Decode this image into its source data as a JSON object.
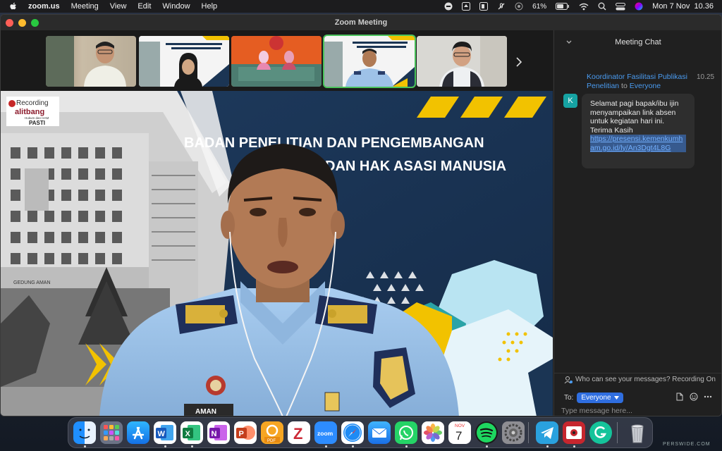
{
  "menubar": {
    "app_name": "zoom.us",
    "menus": [
      "Meeting",
      "View",
      "Edit",
      "Window",
      "Help"
    ],
    "battery": "61%",
    "datetime": "Mon 7 Nov  10.36"
  },
  "window": {
    "title": "Zoom Meeting"
  },
  "gallery": {
    "thumbnails": [
      "participant-1",
      "participant-2",
      "participant-3",
      "participant-4",
      "participant-5"
    ],
    "active_index": 3,
    "next_icon": "chevron-right-icon"
  },
  "main_video": {
    "banner_line1": "BADAN PENELITIAN DAN PENGEMBANGAN",
    "banner_line2": "DAN HAK ASASI MANUSIA",
    "logo_text": "Recording",
    "logo_brand": "alitbang",
    "logo_sub": "Hukum dan HAM",
    "logo_tag": "PASTI",
    "building_sign": "GEDUNG AMAN",
    "name_tag": "AMAN"
  },
  "chat": {
    "header": "Meeting Chat",
    "message": {
      "sender": "Koordinator Fasilitasi Publikasi Penelitian",
      "to_word": "to",
      "recipient": "Everyone",
      "time": "10.25",
      "avatar_letter": "K",
      "text": "Selamat pagi bapak/ibu ijin menyampaikan link absen untuk kegiatan hari ini. Terima Kasih",
      "link": "https://presensi.kemenkumham.go.id/ly/An3Dgt4L8G"
    },
    "notice": "Who can see your messages? Recording On",
    "to_label": "To:",
    "to_value": "Everyone",
    "input_placeholder": "Type message here..."
  },
  "dock": {
    "apps": [
      "Finder",
      "Launchpad",
      "App Store",
      "Word",
      "Excel",
      "OneNote",
      "PowerPoint",
      "PDF",
      "Zotero",
      "Zoom",
      "Safari",
      "Mail",
      "WhatsApp",
      "Photos",
      "Calendar",
      "Spotify",
      "System Preferences",
      "Telegram",
      "Photo Booth",
      "Grammarly",
      "Trash"
    ],
    "calendar_month": "NOV",
    "calendar_day": "7",
    "zoom_label": "zoom"
  },
  "watermark": "PERSWIDE.COM",
  "colors": {
    "accent": "#2f6ee0",
    "link": "#4a9bf0",
    "active_tile": "#4ac25b",
    "banner_bg": "#1b3554",
    "uniform": "#9ec2e8"
  }
}
